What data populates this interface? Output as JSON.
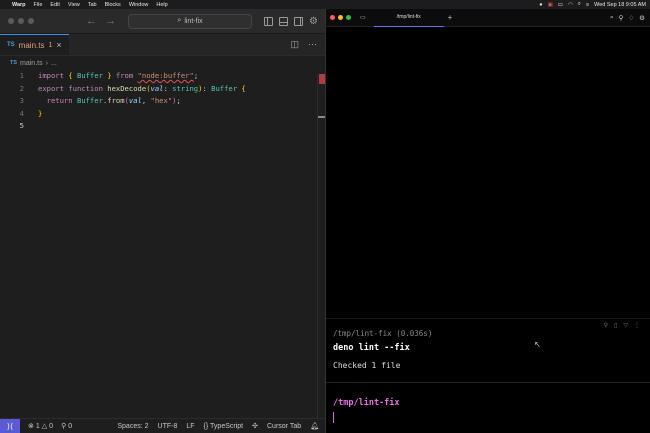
{
  "menubar": {
    "app_name": "Warp",
    "items": [
      "File",
      "Edit",
      "View",
      "Tab",
      "Blocks",
      "Window",
      "Help"
    ],
    "clock": "Wed Sep 18  9:05 AM"
  },
  "editor": {
    "search_text": "lint-fix",
    "tab": {
      "lang_badge": "TS",
      "filename": "main.ts",
      "problem_count": "1",
      "close_glyph": "×"
    },
    "breadcrumb": {
      "lang_badge": "TS",
      "file": "main.ts",
      "sep": "›",
      "rest": "..."
    },
    "code_lines": [
      {
        "n": "1"
      },
      {
        "n": "2"
      },
      {
        "n": "3"
      },
      {
        "n": "4"
      },
      {
        "n": "5"
      }
    ],
    "code": {
      "l1_import": "import",
      "l1_open": "{",
      "l1_id": "Buffer",
      "l1_close": "}",
      "l1_from": "from",
      "l1_str": "\"node:buffer\"",
      "l1_semi": ";",
      "l2_export": "export",
      "l2_function": "function",
      "l2_name": "hexDecode",
      "l2_param": "val",
      "l2_type": "string",
      "l2_ret": "Buffer",
      "l3_return": "return",
      "l3_obj": "Buffer",
      "l3_method": "from",
      "l3_arg": "val",
      "l3_str": "\"hex\"",
      "l4_close": "}"
    },
    "status": {
      "errors": "1",
      "warnings": "0",
      "ports": "0",
      "spaces": "Spaces: 2",
      "encoding": "UTF-8",
      "eol": "LF",
      "language": "TypeScript",
      "extension": "Cursor Tab"
    }
  },
  "warp": {
    "tab_title": "/tmp/lint-fix",
    "block": {
      "meta": "/tmp/lint-fix (0.036s)",
      "command": "deno lint --fix",
      "output": "Checked 1 file"
    },
    "prompt": "/tmp/lint-fix"
  },
  "colors": {
    "accent": "#5a5ad8",
    "warp_tab_underline": "#6b6bff",
    "prompt": "#e86fe8",
    "error": "#b43b3b"
  }
}
